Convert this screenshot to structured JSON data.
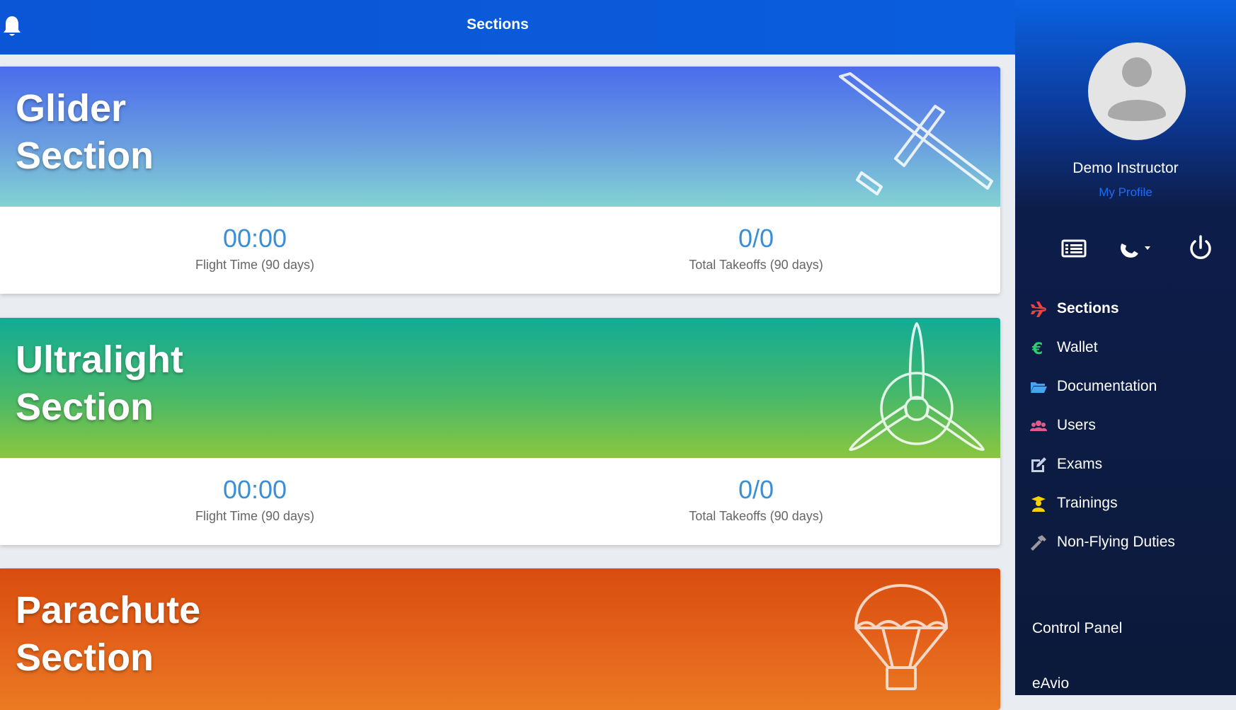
{
  "header": {
    "title": "Sections"
  },
  "sections": [
    {
      "title_line1": "Glider",
      "title_line2": "Section",
      "flight_time": "00:00",
      "flight_time_label": "Flight Time (90 days)",
      "takeoffs": "0/0",
      "takeoffs_label": "Total Takeoffs (90 days)",
      "icon": "glider-icon"
    },
    {
      "title_line1": "Ultralight",
      "title_line2": "Section",
      "flight_time": "00:00",
      "flight_time_label": "Flight Time (90 days)",
      "takeoffs": "0/0",
      "takeoffs_label": "Total Takeoffs (90 days)",
      "icon": "propeller-icon"
    },
    {
      "title_line1": "Parachute",
      "title_line2": "Section",
      "icon": "parachute-icon"
    }
  ],
  "sidebar": {
    "user_name": "Demo Instructor",
    "profile_link": "My Profile",
    "tools": [
      "list-icon",
      "phone-dropdown-icon",
      "power-icon"
    ],
    "menu": [
      {
        "label": "Sections",
        "icon": "plane-icon",
        "color": "#e8453c",
        "active": true
      },
      {
        "label": "Wallet",
        "icon": "euro-icon",
        "color": "#2ecc71"
      },
      {
        "label": "Documentation",
        "icon": "folder-icon",
        "color": "#4aa3f0"
      },
      {
        "label": "Users",
        "icon": "users-icon",
        "color": "#e05c8a"
      },
      {
        "label": "Exams",
        "icon": "edit-icon",
        "color": "#c7d0e6"
      },
      {
        "label": "Trainings",
        "icon": "graduate-icon",
        "color": "#f5d100"
      },
      {
        "label": "Non-Flying Duties",
        "icon": "hammer-icon",
        "color": "#9a9aa0"
      }
    ],
    "control_panel": "Control Panel",
    "brand": "eAvio"
  }
}
